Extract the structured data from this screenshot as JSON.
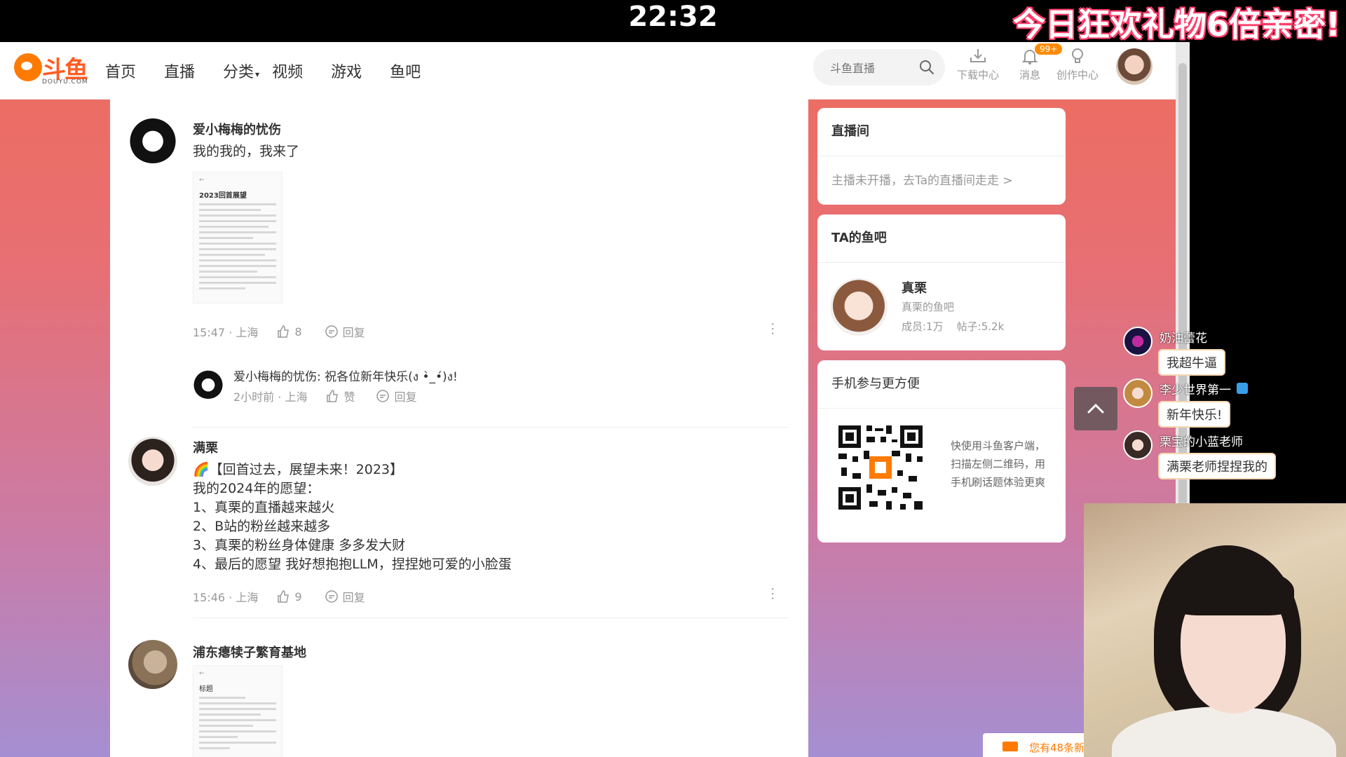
{
  "overlay": {
    "clock": "22:32",
    "promo": "今日狂欢礼物6倍亲密!"
  },
  "nav": {
    "logo_text": "斗鱼",
    "logo_sub": "DOUYU.COM",
    "links": [
      "首页",
      "直播",
      "分类",
      "视频",
      "游戏",
      "鱼吧"
    ],
    "search_placeholder": "斗鱼直播",
    "download": "下载中心",
    "messages": "消息",
    "messages_badge": "99+",
    "creator": "创作中心"
  },
  "posts": [
    {
      "author": "爱小梅梅的忧伤",
      "text": "我的我的，我来了",
      "doc_title": "2023回首展望",
      "time_loc": "15:47 · 上海",
      "likes": "8",
      "reply_label": "回复",
      "reply": {
        "author": "爱小梅梅的忧伤",
        "text": "祝各位新年快乐(ง •̀_•́)ง!",
        "time_loc": "2小时前 · 上海",
        "like_label": "赞",
        "reply_label": "回复"
      }
    },
    {
      "author": "满栗",
      "text": "🌈【回首过去，展望未来！2023】\n我的2024年的愿望：\n1、真栗的直播越来越火\n2、B站的粉丝越来越多\n3、真栗的粉丝身体健康 多多发大财\n4、最后的愿望 我好想抱抱LLM，捏捏她可爱的小脸蛋",
      "time_loc": "15:46 · 上海",
      "likes": "9",
      "reply_label": "回复"
    },
    {
      "author": "浦东瘪犊子繁育基地",
      "doc_title": "标题"
    }
  ],
  "sidebar": {
    "live_title": "直播间",
    "live_msg": "主播未开播，去Ta的直播间走走 >",
    "bar_title": "TA的鱼吧",
    "bar_name": "真栗",
    "bar_desc": "真栗的鱼吧",
    "bar_stats": "成员:1万    帖子:5.2k",
    "mobile_title": "手机参与更方便",
    "mobile_text": "快使用斗鱼客户端，扫描左侧二维码，用手机刷话题体验更爽"
  },
  "notice": "您有48条新",
  "chat": [
    {
      "name": "奶油蕾花",
      "msg": "我超牛逼"
    },
    {
      "name": "李少世界第一",
      "msg": "新年快乐!"
    },
    {
      "name": "栗宝的小蓝老师",
      "msg": "满栗老师捏捏我的"
    }
  ],
  "colors": {
    "brand": "#ff5d23",
    "badge": "#ff8a00"
  }
}
